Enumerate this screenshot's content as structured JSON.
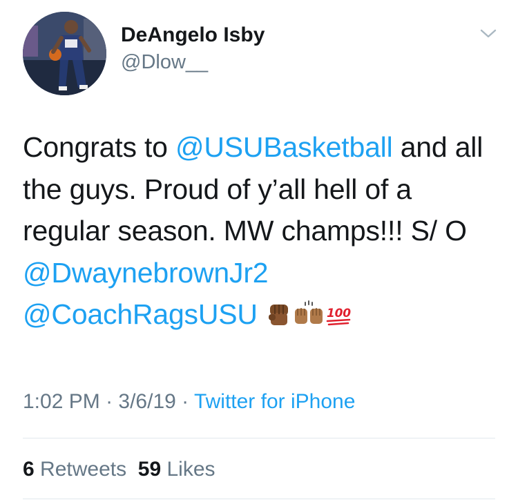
{
  "user": {
    "name": "DeAngelo Isby",
    "handle": "@Dlow__"
  },
  "tweet": {
    "part1": "Congrats to ",
    "mention1": "@USUBasketball",
    "part2": " and all the guys. Proud of y’all hell of a regular season. MW champs!!! S/ O ",
    "mention2": "@DwaynebrownJr2",
    "part3": " ",
    "mention3": "@CoachRagsUSU",
    "emojis": [
      "fist-icon",
      "raised-hands-icon",
      "hundred-points-icon"
    ]
  },
  "meta": {
    "time": "1:02 PM",
    "sep1": " · ",
    "date": "3/6/19",
    "sep2": " · ",
    "source": "Twitter for iPhone"
  },
  "stats": {
    "retweets_count": "6",
    "retweets_label": "Retweets",
    "likes_count": "59",
    "likes_label": "Likes"
  },
  "colors": {
    "link": "#1da1f2",
    "secondary": "#657786",
    "primary": "#14171a",
    "divider": "#e1e8ed"
  }
}
